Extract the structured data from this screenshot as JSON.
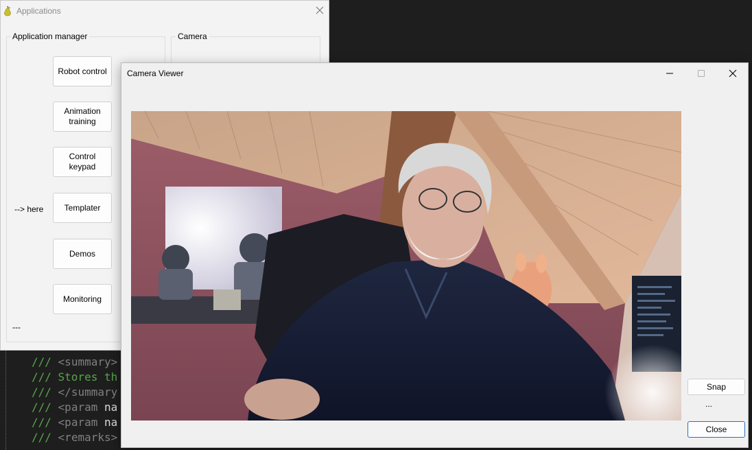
{
  "editor": {
    "lines": [
      {
        "comment": "///",
        "tag": "<summary>",
        "rest": ""
      },
      {
        "comment": "/// Stores th",
        "tag": "",
        "rest": ""
      },
      {
        "comment": "///",
        "tag": "</summary",
        "rest": ""
      },
      {
        "comment": "///",
        "tag": "<param",
        "rest": "na"
      },
      {
        "comment": "///",
        "tag": "<param",
        "rest": "na"
      },
      {
        "comment": "///",
        "tag": "<remarks>",
        "rest": ""
      }
    ]
  },
  "applications_window": {
    "title": "Applications",
    "icon": "pear-icon",
    "app_manager_group": {
      "label": "Application manager",
      "buttons": [
        {
          "label": "Robot control"
        },
        {
          "label": "Animation training"
        },
        {
          "label": "Control keypad"
        },
        {
          "label": "Templater"
        },
        {
          "label": "Demos"
        },
        {
          "label": "Monitoring"
        }
      ],
      "here_label": "--> here",
      "footer": "---"
    },
    "camera_group": {
      "label": "Camera"
    }
  },
  "camera_window": {
    "title": "Camera Viewer",
    "controls": {
      "minimize": "minimize-icon",
      "maximize": "maximize-icon",
      "close": "close-icon"
    },
    "snap_label": "Snap",
    "status_text": "...",
    "close_label": "Close"
  }
}
